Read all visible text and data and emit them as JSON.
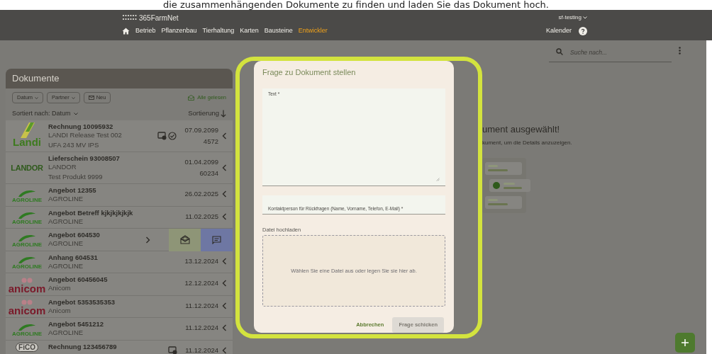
{
  "caption": "die zusammenhängenden Dokumente zu finden und laden Sie das Dokument hoch.",
  "header": {
    "brand": "365FarmNet",
    "account": "sf-testing",
    "nav": [
      {
        "label": "Betrieb",
        "selected": false
      },
      {
        "label": "Pflanzenbau",
        "selected": false
      },
      {
        "label": "Tierhaltung",
        "selected": false
      },
      {
        "label": "Karten",
        "selected": false
      },
      {
        "label": "Bausteine",
        "selected": false
      },
      {
        "label": "Entwickler",
        "selected": true
      }
    ],
    "calendar": "Kalender"
  },
  "documents": {
    "title": "Dokumente",
    "filters": [
      {
        "label": "Datum",
        "kind": "dropdown"
      },
      {
        "label": "Partner",
        "kind": "dropdown"
      },
      {
        "label": "Neu",
        "kind": "mail"
      }
    ],
    "mark_all_read": "Alle gelesen",
    "sorted_by": "Sortiert nach: Datum",
    "sort": "Sortierung",
    "rows": [
      {
        "logo": {
          "kind": "landi",
          "text": "Landi"
        },
        "title": "Rechnung 10095932",
        "partner": "LANDI Release Test 002",
        "detail": "UFA 243 MV IPS",
        "icons": [
          {
            "kind": "invoice"
          },
          {
            "kind": "check"
          }
        ],
        "date": "07.09.2099",
        "number": "4572",
        "swiped": false
      },
      {
        "logo": {
          "kind": "landor",
          "text": "LANDOR"
        },
        "title": "Lieferschein 93008507",
        "partner": "LANDOR",
        "detail": "Test Produkt 9999",
        "icons": [],
        "date": "01.04.2099",
        "number": "60234",
        "swiped": false
      },
      {
        "logo": {
          "kind": "agroline",
          "text": "AGROLINE"
        },
        "title": "Angebot 12355",
        "partner": "AGROLINE",
        "icons": [],
        "date": "26.02.2025",
        "swiped": false
      },
      {
        "logo": {
          "kind": "agroline",
          "text": "AGROLINE"
        },
        "title": "Angebot Betreff kjkjkjkjkjk",
        "partner": "AGROLINE",
        "icons": [],
        "date": "11.02.2025",
        "swiped": false
      },
      {
        "logo": {
          "kind": "agroline",
          "text": "AGROLINE"
        },
        "title": "Angebot 604530",
        "partner": "AGROLINE",
        "icons": [],
        "swiped": true
      },
      {
        "logo": {
          "kind": "agroline",
          "text": "AGROLINE"
        },
        "title": "Anhang 604531",
        "partner": "AGROLINE",
        "icons": [],
        "date": "13.12.2024",
        "swiped": false
      },
      {
        "logo": {
          "kind": "anicom",
          "text": "anicom"
        },
        "title": "Angebot 60456045",
        "partner": "Anicom",
        "icons": [],
        "date": "12.12.2024",
        "swiped": false
      },
      {
        "logo": {
          "kind": "anicom",
          "text": "anicom"
        },
        "title": "Angebot 5353535353",
        "partner": "Anicom",
        "icons": [],
        "date": "11.12.2024",
        "swiped": false
      },
      {
        "logo": {
          "kind": "agroline",
          "text": "AGROLINE"
        },
        "title": "Angebot 5451212",
        "partner": "AGROLINE",
        "icons": [],
        "date": "11.12.2024",
        "swiped": false
      },
      {
        "logo": {
          "kind": "fico",
          "text": "FiCO"
        },
        "title": "Rechnung 123456789",
        "icons": [
          {
            "kind": "invoice"
          }
        ],
        "date": "11.12.2024",
        "swiped": false
      }
    ]
  },
  "search": {
    "placeholder": "Suche nach..."
  },
  "empty_state": {
    "title": "ument ausgewählt!",
    "text": "kument, um die Details anzuzeigen."
  },
  "dialog": {
    "title": "Frage zu Dokument stellen",
    "text_label": "Text *",
    "contact_label": "Kontaktperson für Rückfragen (Name, Vorname, Telefon, E-Mail) *",
    "upload_label": "Datei hochladen",
    "dropzone": "Wählen Sie eine Datei aus oder legen Sie sie hier ab.",
    "cancel": "Abbrechen",
    "submit": "Frage schicken",
    "submit_disabled": true
  }
}
